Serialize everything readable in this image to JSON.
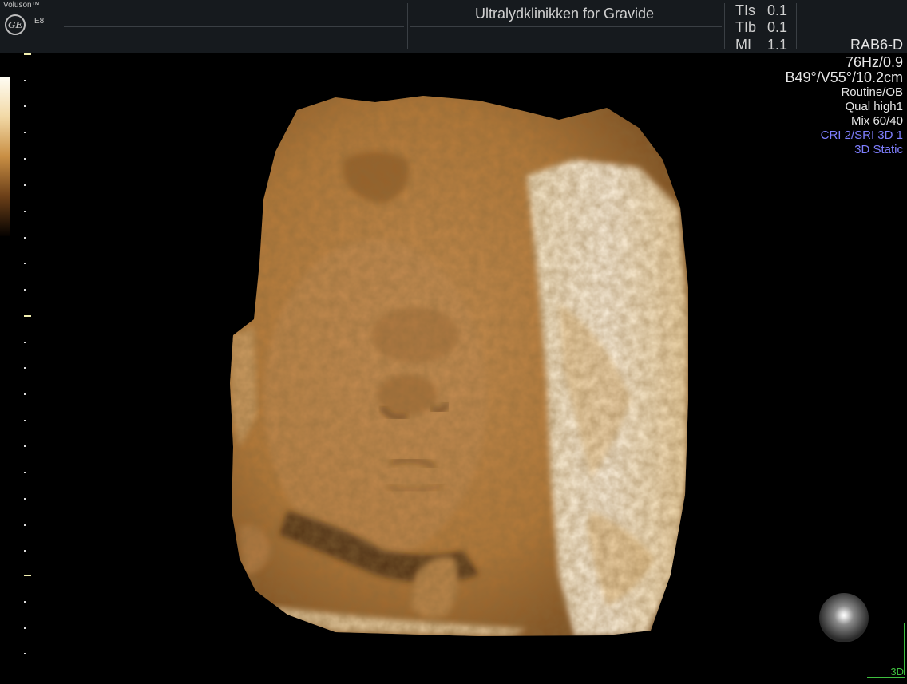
{
  "header": {
    "brand": "Voluson™",
    "logo_text": "GE",
    "model": "E8",
    "clinic": "Ultralydklinikken for Gravide",
    "indices": [
      {
        "label": "TIs",
        "value": "0.1"
      },
      {
        "label": "TIb",
        "value": "0.1"
      },
      {
        "label": "MI",
        "value": "1.1"
      }
    ]
  },
  "info": {
    "probe": "RAB6-D",
    "frame_rate": "76Hz/0.9",
    "angles_depth": "B49°/V55°/10.2cm",
    "preset": "Routine/OB",
    "quality": "Qual high1",
    "mix": "Mix 60/40",
    "filters": "CRI 2/SRI 3D 1",
    "mode": "3D Static"
  },
  "footer": {
    "mode_label": "3D"
  },
  "colors": {
    "header_bg": "#161a1e",
    "info_text": "#e6e6e6",
    "info_blue": "#7f7fff",
    "mode_green": "#3fbf3f",
    "skin_mid": "#c98f44"
  },
  "icons": {
    "logo": "ge-logo-icon",
    "orientation": "orientation-sphere-icon"
  }
}
